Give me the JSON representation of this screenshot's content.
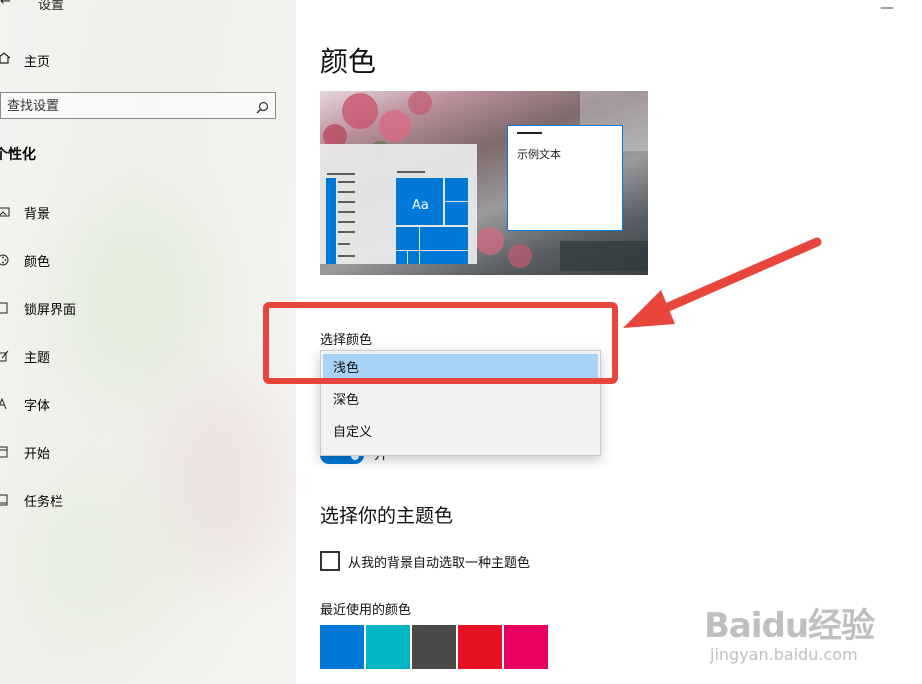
{
  "window": {
    "title": "设置",
    "back_glyph": "←",
    "close_glyph": "—"
  },
  "sidebar": {
    "home_label": "主页",
    "search_placeholder": "查找设置",
    "section_title": "个性化",
    "items": [
      {
        "label": "背景",
        "icon": "picture-icon"
      },
      {
        "label": "颜色",
        "icon": "palette-icon"
      },
      {
        "label": "锁屏界面",
        "icon": "lock-screen-icon"
      },
      {
        "label": "主题",
        "icon": "brush-icon"
      },
      {
        "label": "字体",
        "icon": "font-icon"
      },
      {
        "label": "开始",
        "icon": "start-icon"
      },
      {
        "label": "任务栏",
        "icon": "taskbar-icon"
      }
    ]
  },
  "main": {
    "title": "颜色",
    "preview": {
      "sample_text": "示例文本",
      "tile_label": "Aa"
    },
    "choose_color_label": "选择颜色",
    "dropdown_options": [
      "浅色",
      "深色",
      "自定义"
    ],
    "selected_option": "浅色",
    "toggle_label": "开",
    "accent_title": "选择你的主题色",
    "auto_accent_label": "从我的背景自动选取一种主题色",
    "recent_colors_label": "最近使用的颜色",
    "recent_colors": [
      "#0078d7",
      "#00b7c3",
      "#4c4a48",
      "#e81123",
      "#ea005e"
    ]
  },
  "watermark": {
    "brand": "Baidu经验",
    "url": "jingyan.baidu.com"
  },
  "colors": {
    "accent": "#0078d7",
    "annotation": "#e8453c",
    "dropdown_selected": "#a8d3f8"
  }
}
